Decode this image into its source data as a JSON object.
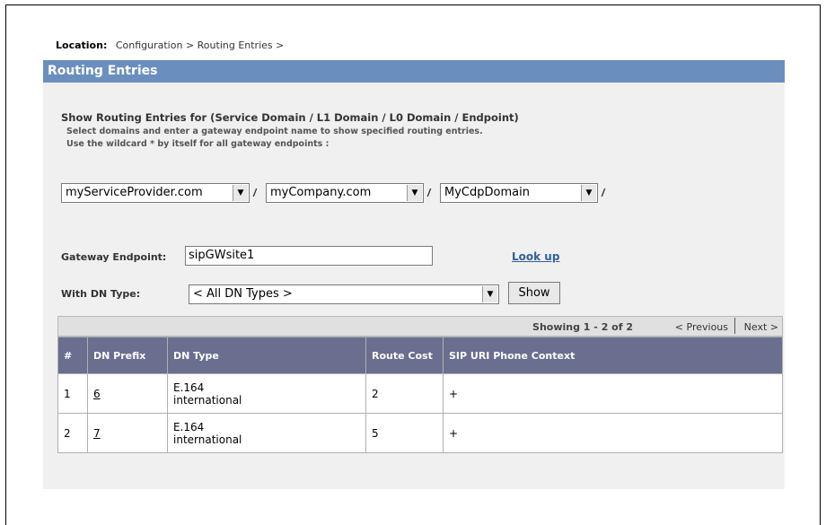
{
  "location": {
    "label": "Location",
    "path": "Configuration > Routing Entries >"
  },
  "panel": {
    "title": "Routing Entries"
  },
  "instructions": {
    "line1": "Show Routing Entries for (Service Domain / L1 Domain / L0 Domain / Endpoint)",
    "line2": "Select domains and enter a gateway endpoint name to show specified routing entries.",
    "line3": "Use the wildcard * by itself for all gateway endpoints :"
  },
  "domains": {
    "service_domain": "myServiceProvider.com",
    "l1_domain": "myCompany.com",
    "l0_domain": "MyCdpDomain",
    "separator": "/"
  },
  "gateway": {
    "label": "Gateway Endpoint:",
    "value": "sipGWsite1",
    "lookup_label": "Look up"
  },
  "dn_type": {
    "label": "With DN Type:",
    "value": "< All DN Types >",
    "show_label": "Show"
  },
  "pager": {
    "showing": "Showing 1 - 2 of 2",
    "previous": "< Previous",
    "next": "Next >"
  },
  "table": {
    "headers": [
      "#",
      "DN Prefix",
      "DN Type",
      "Route Cost",
      "SIP URI Phone Context"
    ],
    "rows": [
      {
        "num": "1",
        "prefix": "6",
        "type_line1": "E.164",
        "type_line2": "international",
        "cost": "2",
        "context": "+"
      },
      {
        "num": "2",
        "prefix": "7",
        "type_line1": "E.164",
        "type_line2": "international",
        "cost": "5",
        "context": "+"
      }
    ]
  },
  "colors": {
    "header_bar": "#6a8fbf",
    "table_header": "#6a6e8f",
    "panel_bg": "#f0f0f0",
    "link": "#335f99"
  }
}
